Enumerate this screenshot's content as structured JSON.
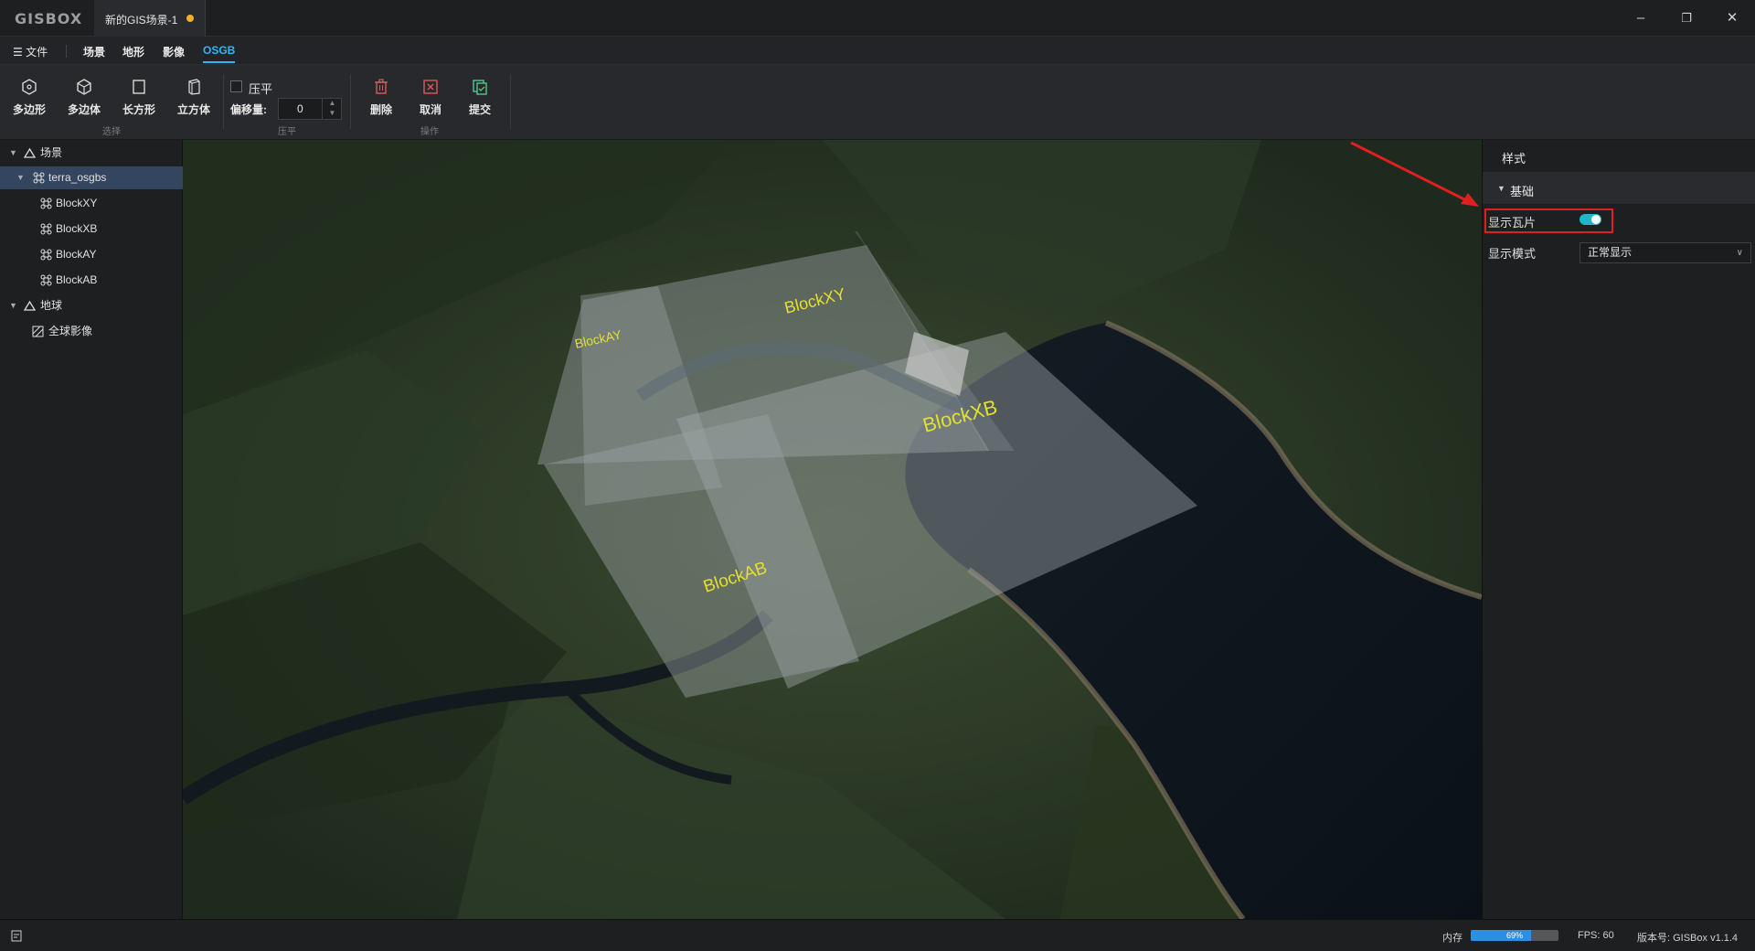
{
  "app": {
    "logo": "GISBOX",
    "document_tab": "新的GIS场景-1",
    "window_controls": {
      "minimize": "–",
      "restore": "❐",
      "close": "✕"
    }
  },
  "menu": {
    "file": "☰ 文件",
    "items": [
      "场景",
      "地形",
      "影像",
      "OSGB"
    ],
    "active": "OSGB"
  },
  "toolbar": {
    "select_group": {
      "label": "选择",
      "tools": [
        "多边形",
        "多边体",
        "长方形",
        "立方体"
      ]
    },
    "flatten_group": {
      "label": "压平",
      "checkbox_label": "压平",
      "checked": false,
      "offset_label": "偏移量:",
      "offset_value": "0"
    },
    "operation_group": {
      "label": "操作",
      "tools": [
        "删除",
        "取消",
        "提交"
      ]
    }
  },
  "tree": {
    "scene": "场景",
    "terra": "terra_osgbs",
    "blocks": [
      "BlockXY",
      "BlockXB",
      "BlockAY",
      "BlockAB"
    ],
    "globe": "地球",
    "imagery": "全球影像"
  },
  "viewport": {
    "block_labels": [
      "BlockXY",
      "BlockAY",
      "BlockXB",
      "BlockAB"
    ]
  },
  "properties": {
    "tab": "样式",
    "section": "基础",
    "show_tiles_label": "显示瓦片",
    "show_tiles": true,
    "display_mode_label": "显示模式",
    "display_mode_value": "正常显示"
  },
  "status": {
    "memory_label": "内存",
    "memory_percent": "69%",
    "memory_fraction": 0.69,
    "fps": "FPS: 60",
    "version": "版本号: GISBox v1.1.4"
  },
  "colors": {
    "accent": "#2fb7f5",
    "toggle": "#23b5c9",
    "highlight": "#e02020",
    "label_yellow": "#e4e02a",
    "unsaved_dot": "#f0b02a"
  }
}
